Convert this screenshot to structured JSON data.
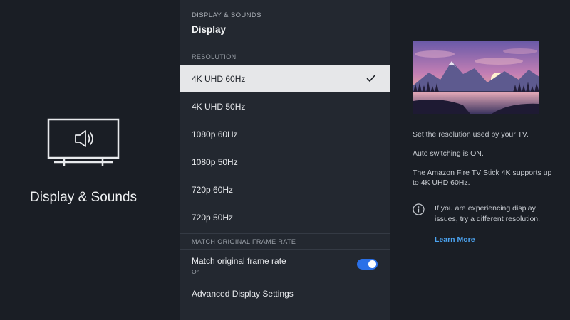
{
  "left": {
    "title": "Display & Sounds",
    "icon": "tv-speaker-icon"
  },
  "menu": {
    "breadcrumb": "DISPLAY & SOUNDS",
    "title": "Display",
    "resolution_label": "RESOLUTION",
    "resolutions": [
      {
        "label": "4K UHD 60Hz",
        "selected": true
      },
      {
        "label": "4K UHD 50Hz",
        "selected": false
      },
      {
        "label": "1080p 60Hz",
        "selected": false
      },
      {
        "label": "1080p 50Hz",
        "selected": false
      },
      {
        "label": "720p 60Hz",
        "selected": false
      },
      {
        "label": "720p 50Hz",
        "selected": false
      }
    ],
    "frame_rate_label": "MATCH ORIGINAL FRAME RATE",
    "match_frame_rate": {
      "label": "Match original frame rate",
      "status": "On",
      "enabled": true
    },
    "advanced": "Advanced Display Settings"
  },
  "right": {
    "description": "Set the resolution used by your TV.",
    "auto_switching": "Auto switching is ON.",
    "support_note": "The Amazon Fire TV Stick 4K supports up to 4K UHD 60Hz.",
    "info_note": "If you are experiencing display issues, try a different resolution.",
    "learn_more": "Learn More"
  },
  "colors": {
    "background": "#1a1e25",
    "menu_panel": "#232830",
    "selected_row": "#e6e7e9",
    "toggle_on": "#2a70e8",
    "link": "#4ba3f0"
  }
}
